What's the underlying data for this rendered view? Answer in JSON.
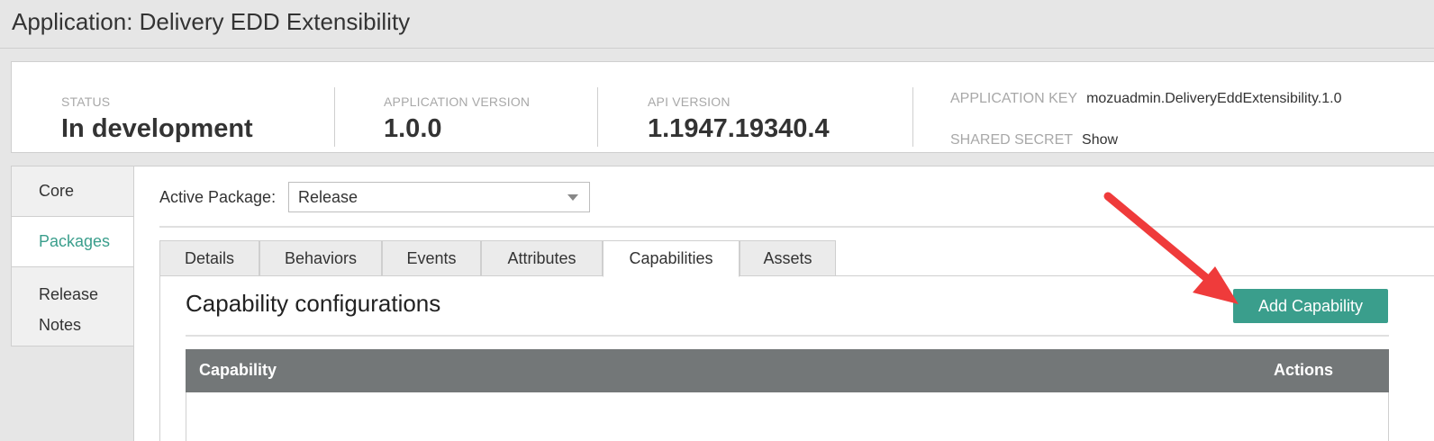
{
  "page": {
    "title": "Application: Delivery EDD Extensibility"
  },
  "info": {
    "status_label": "STATUS",
    "status_value": "In development",
    "app_version_label": "APPLICATION VERSION",
    "app_version_value": "1.0.0",
    "api_version_label": "API VERSION",
    "api_version_value": "1.1947.19340.4",
    "app_key_label": "APPLICATION KEY",
    "app_key_value": "mozuadmin.DeliveryEddExtensibility.1.0",
    "shared_secret_label": "SHARED SECRET",
    "shared_secret_value": "Show"
  },
  "sidebar": {
    "items": [
      {
        "label": "Core"
      },
      {
        "label": "Packages"
      },
      {
        "label_line1": "Release",
        "label_line2": "Notes"
      }
    ]
  },
  "package": {
    "label": "Active Package:",
    "selected": "Release"
  },
  "tabs": [
    {
      "label": "Details"
    },
    {
      "label": "Behaviors"
    },
    {
      "label": "Events"
    },
    {
      "label": "Attributes"
    },
    {
      "label": "Capabilities"
    },
    {
      "label": "Assets"
    }
  ],
  "capabilities": {
    "title": "Capability configurations",
    "add_button": "Add Capability",
    "columns": {
      "capability": "Capability",
      "actions": "Actions"
    }
  },
  "colors": {
    "accent": "#3a9e8c",
    "grid_header": "#737778",
    "annotation_arrow": "#ef3b3b"
  },
  "annotation": {
    "type": "arrow",
    "points_to": "add-capability-button"
  }
}
